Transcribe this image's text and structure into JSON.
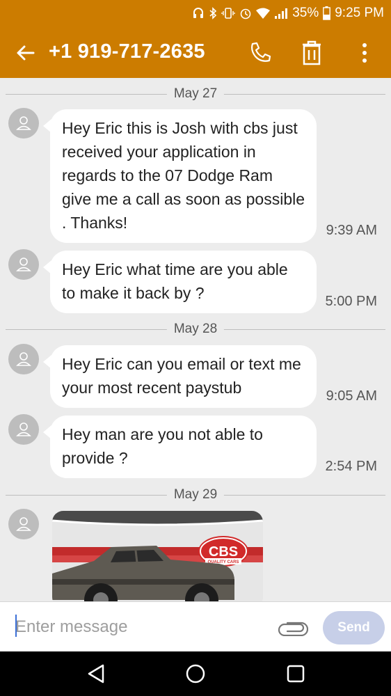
{
  "status_bar": {
    "battery": "35%",
    "time": "9:25 PM",
    "icons": [
      "headphones-icon",
      "bluetooth-icon",
      "vibrate-icon",
      "alarm-icon",
      "wifi-icon",
      "signal-icon",
      "battery-icon"
    ]
  },
  "header": {
    "title": "+1 919-717-2635",
    "icons": [
      "back-arrow-icon",
      "phone-icon",
      "trash-icon",
      "more-vert-icon"
    ]
  },
  "conversation": {
    "days": [
      {
        "date": "May 27",
        "messages": [
          {
            "text": "Hey Eric this is Josh with cbs just received your application in regards to the 07 Dodge Ram give me a call as soon as possible . Thanks!",
            "time": "9:39 AM"
          },
          {
            "text": "Hey Eric what time are you able to make it back by ?",
            "time": "5:00 PM"
          }
        ]
      },
      {
        "date": "May 28",
        "messages": [
          {
            "text": "Hey Eric can you email or text me your most recent paystub",
            "time": "9:05 AM"
          },
          {
            "text": "Hey man are you not able to provide ?",
            "time": "2:54 PM"
          }
        ]
      },
      {
        "date": "May 29",
        "image_message": {
          "logo_text": "CBS",
          "logo_subtext": "QUALITY CARS"
        }
      }
    ]
  },
  "composer": {
    "placeholder": "Enter message",
    "send_label": "Send",
    "icons": [
      "attachment-icon"
    ]
  },
  "nav_bar": {
    "icons": [
      "nav-back-icon",
      "nav-home-icon",
      "nav-recents-icon"
    ]
  },
  "colors": {
    "app_bar": "#cc7c00",
    "background": "#ececec",
    "bubble": "#ffffff",
    "send_button": "#c7cfe8",
    "nav_bar": "#000000"
  }
}
